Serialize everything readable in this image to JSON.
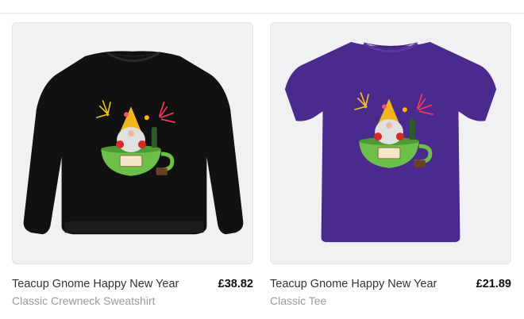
{
  "products": [
    {
      "title": "Teacup Gnome Happy New Year",
      "subtitle": "Classic Crewneck Sweatshirt",
      "price": "£38.82",
      "garment_color": "#111111"
    },
    {
      "title": "Teacup Gnome Happy New Year",
      "subtitle": "Classic Tee",
      "price": "£21.89",
      "garment_color": "#4a2a8c"
    }
  ],
  "colors": {
    "card_background": "#f1f1f3",
    "title": "#333333",
    "subtitle": "#9a9a9a",
    "price": "#111111"
  }
}
